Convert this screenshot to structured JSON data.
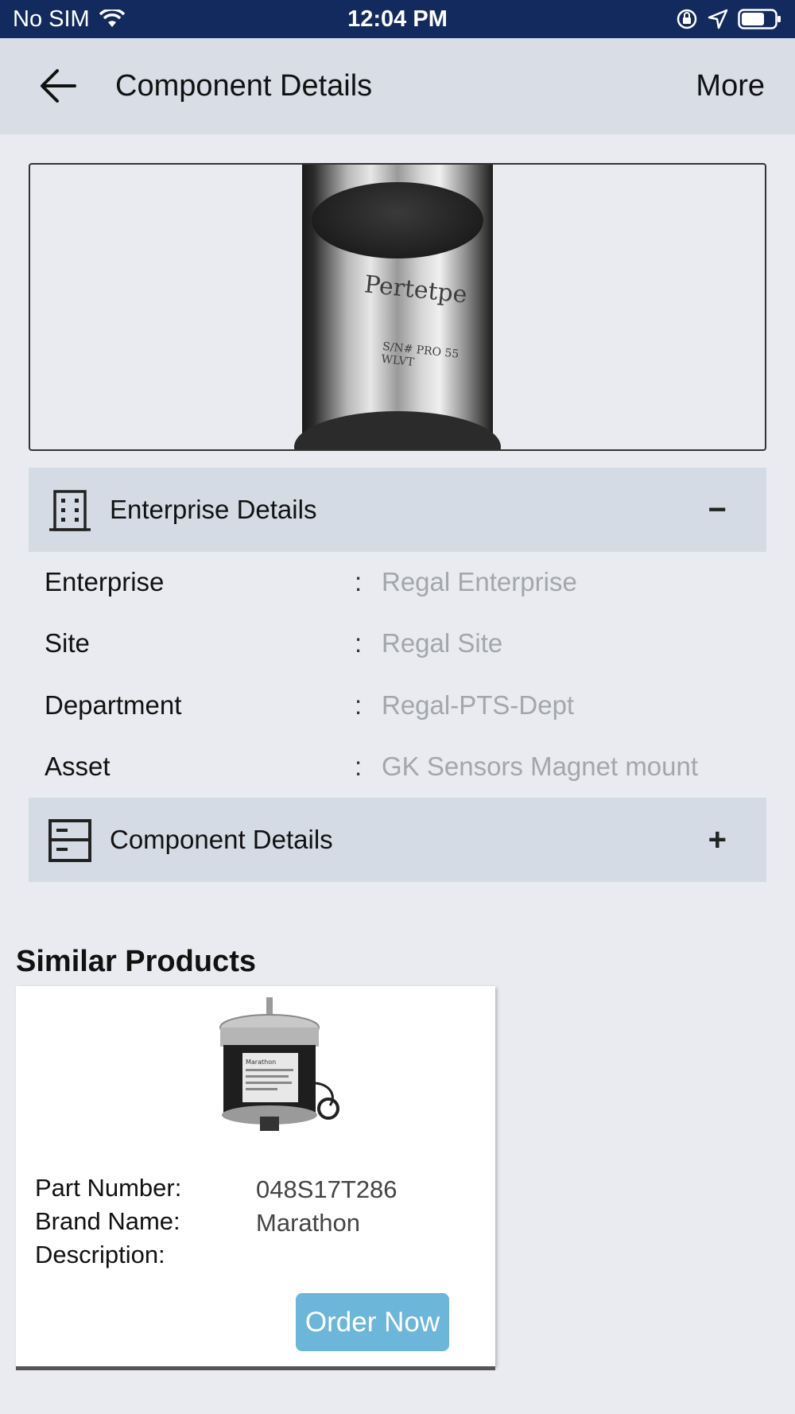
{
  "status_bar": {
    "carrier": "No SIM",
    "time": "12:04 PM"
  },
  "nav": {
    "title": "Component Details",
    "more_label": "More"
  },
  "carousel": {
    "photo_engraving_1": "Pertetpe",
    "photo_engraving_2": "S/N# PRO 55 WLVT",
    "active_page": 1,
    "page_count": 1
  },
  "enterprise_section": {
    "title": "Enterprise Details",
    "toggle": "−",
    "rows": [
      {
        "label": "Enterprise",
        "separator": ":",
        "value": "Regal Enterprise"
      },
      {
        "label": "Site",
        "separator": ":",
        "value": "Regal Site"
      },
      {
        "label": "Department",
        "separator": ":",
        "value": "Regal-PTS-Dept"
      },
      {
        "label": "Asset",
        "separator": ":",
        "value": "GK Sensors Magnet mount"
      }
    ]
  },
  "component_section": {
    "title": "Component Details",
    "toggle": "+"
  },
  "similar_products": {
    "title": "Similar Products",
    "items": [
      {
        "part_number_label": "Part Number:",
        "part_number": "048S17T286",
        "brand_label": "Brand Name:",
        "brand": "Marathon",
        "description_label": "Description:",
        "description": "",
        "order_label": "Order Now",
        "product_badge": "Marathon"
      }
    ]
  },
  "colors": {
    "status_bar": "#132a5e",
    "nav_bar": "#d8dde6",
    "section_header": "#d5dbe5",
    "background": "#e9ebf0",
    "value_text": "#a3a6ab",
    "order_button": "#6cb6d9"
  }
}
